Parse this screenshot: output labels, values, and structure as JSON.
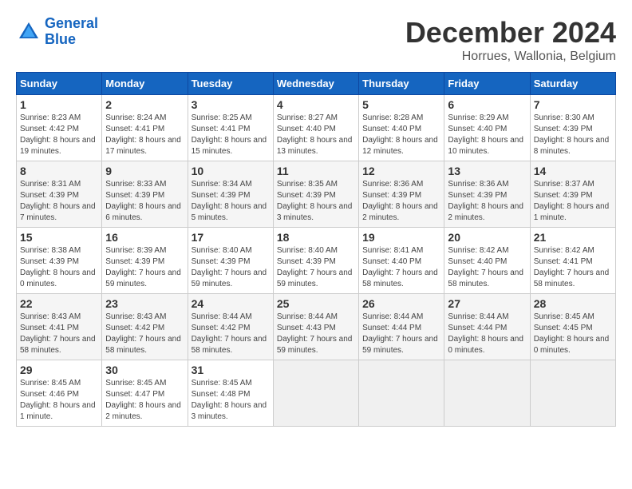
{
  "header": {
    "logo_line1": "General",
    "logo_line2": "Blue",
    "month_title": "December 2024",
    "subtitle": "Horrues, Wallonia, Belgium"
  },
  "days_of_week": [
    "Sunday",
    "Monday",
    "Tuesday",
    "Wednesday",
    "Thursday",
    "Friday",
    "Saturday"
  ],
  "weeks": [
    [
      {
        "day": "1",
        "sunrise": "8:23 AM",
        "sunset": "4:42 PM",
        "daylight": "8 hours and 19 minutes."
      },
      {
        "day": "2",
        "sunrise": "8:24 AM",
        "sunset": "4:41 PM",
        "daylight": "8 hours and 17 minutes."
      },
      {
        "day": "3",
        "sunrise": "8:25 AM",
        "sunset": "4:41 PM",
        "daylight": "8 hours and 15 minutes."
      },
      {
        "day": "4",
        "sunrise": "8:27 AM",
        "sunset": "4:40 PM",
        "daylight": "8 hours and 13 minutes."
      },
      {
        "day": "5",
        "sunrise": "8:28 AM",
        "sunset": "4:40 PM",
        "daylight": "8 hours and 12 minutes."
      },
      {
        "day": "6",
        "sunrise": "8:29 AM",
        "sunset": "4:40 PM",
        "daylight": "8 hours and 10 minutes."
      },
      {
        "day": "7",
        "sunrise": "8:30 AM",
        "sunset": "4:39 PM",
        "daylight": "8 hours and 8 minutes."
      }
    ],
    [
      {
        "day": "8",
        "sunrise": "8:31 AM",
        "sunset": "4:39 PM",
        "daylight": "8 hours and 7 minutes."
      },
      {
        "day": "9",
        "sunrise": "8:33 AM",
        "sunset": "4:39 PM",
        "daylight": "8 hours and 6 minutes."
      },
      {
        "day": "10",
        "sunrise": "8:34 AM",
        "sunset": "4:39 PM",
        "daylight": "8 hours and 5 minutes."
      },
      {
        "day": "11",
        "sunrise": "8:35 AM",
        "sunset": "4:39 PM",
        "daylight": "8 hours and 3 minutes."
      },
      {
        "day": "12",
        "sunrise": "8:36 AM",
        "sunset": "4:39 PM",
        "daylight": "8 hours and 2 minutes."
      },
      {
        "day": "13",
        "sunrise": "8:36 AM",
        "sunset": "4:39 PM",
        "daylight": "8 hours and 2 minutes."
      },
      {
        "day": "14",
        "sunrise": "8:37 AM",
        "sunset": "4:39 PM",
        "daylight": "8 hours and 1 minute."
      }
    ],
    [
      {
        "day": "15",
        "sunrise": "8:38 AM",
        "sunset": "4:39 PM",
        "daylight": "8 hours and 0 minutes."
      },
      {
        "day": "16",
        "sunrise": "8:39 AM",
        "sunset": "4:39 PM",
        "daylight": "7 hours and 59 minutes."
      },
      {
        "day": "17",
        "sunrise": "8:40 AM",
        "sunset": "4:39 PM",
        "daylight": "7 hours and 59 minutes."
      },
      {
        "day": "18",
        "sunrise": "8:40 AM",
        "sunset": "4:39 PM",
        "daylight": "7 hours and 59 minutes."
      },
      {
        "day": "19",
        "sunrise": "8:41 AM",
        "sunset": "4:40 PM",
        "daylight": "7 hours and 58 minutes."
      },
      {
        "day": "20",
        "sunrise": "8:42 AM",
        "sunset": "4:40 PM",
        "daylight": "7 hours and 58 minutes."
      },
      {
        "day": "21",
        "sunrise": "8:42 AM",
        "sunset": "4:41 PM",
        "daylight": "7 hours and 58 minutes."
      }
    ],
    [
      {
        "day": "22",
        "sunrise": "8:43 AM",
        "sunset": "4:41 PM",
        "daylight": "7 hours and 58 minutes."
      },
      {
        "day": "23",
        "sunrise": "8:43 AM",
        "sunset": "4:42 PM",
        "daylight": "7 hours and 58 minutes."
      },
      {
        "day": "24",
        "sunrise": "8:44 AM",
        "sunset": "4:42 PM",
        "daylight": "7 hours and 58 minutes."
      },
      {
        "day": "25",
        "sunrise": "8:44 AM",
        "sunset": "4:43 PM",
        "daylight": "7 hours and 59 minutes."
      },
      {
        "day": "26",
        "sunrise": "8:44 AM",
        "sunset": "4:44 PM",
        "daylight": "7 hours and 59 minutes."
      },
      {
        "day": "27",
        "sunrise": "8:44 AM",
        "sunset": "4:44 PM",
        "daylight": "8 hours and 0 minutes."
      },
      {
        "day": "28",
        "sunrise": "8:45 AM",
        "sunset": "4:45 PM",
        "daylight": "8 hours and 0 minutes."
      }
    ],
    [
      {
        "day": "29",
        "sunrise": "8:45 AM",
        "sunset": "4:46 PM",
        "daylight": "8 hours and 1 minute."
      },
      {
        "day": "30",
        "sunrise": "8:45 AM",
        "sunset": "4:47 PM",
        "daylight": "8 hours and 2 minutes."
      },
      {
        "day": "31",
        "sunrise": "8:45 AM",
        "sunset": "4:48 PM",
        "daylight": "8 hours and 3 minutes."
      },
      null,
      null,
      null,
      null
    ]
  ]
}
